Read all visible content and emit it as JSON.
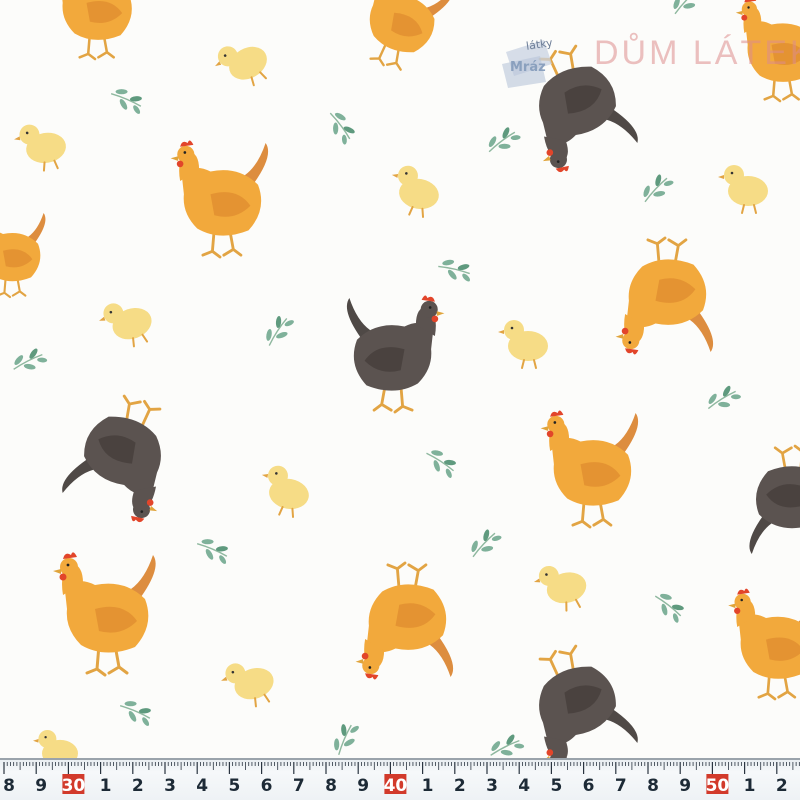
{
  "image": {
    "description_type": "fabric-swatch",
    "background_color": "#fcfcfa"
  },
  "watermark": {
    "badge_small_text": "látky",
    "badge_main_text": "Mráz",
    "brand_text": "DŮM LÁTEK.CZ"
  },
  "ruler": {
    "digit_labels": [
      "8",
      "9",
      "30",
      "1",
      "2",
      "3",
      "4",
      "5",
      "6",
      "7",
      "8",
      "9",
      "40",
      "1",
      "2",
      "3",
      "4",
      "5",
      "6",
      "7",
      "8",
      "9",
      "50",
      "1",
      "2"
    ],
    "highlight_color": "#d23a2b",
    "digit_color": "#1d2a36"
  },
  "colors": {
    "orange_hen": "#f2a93c",
    "orange_hen_dark": "#d9812a",
    "grey_hen": "#5b5350",
    "grey_hen_dark": "#3c3532",
    "chick": "#f6dc86",
    "comb": "#e2452a",
    "leaf": "#7fb19a",
    "leg": "#e2a443"
  }
}
